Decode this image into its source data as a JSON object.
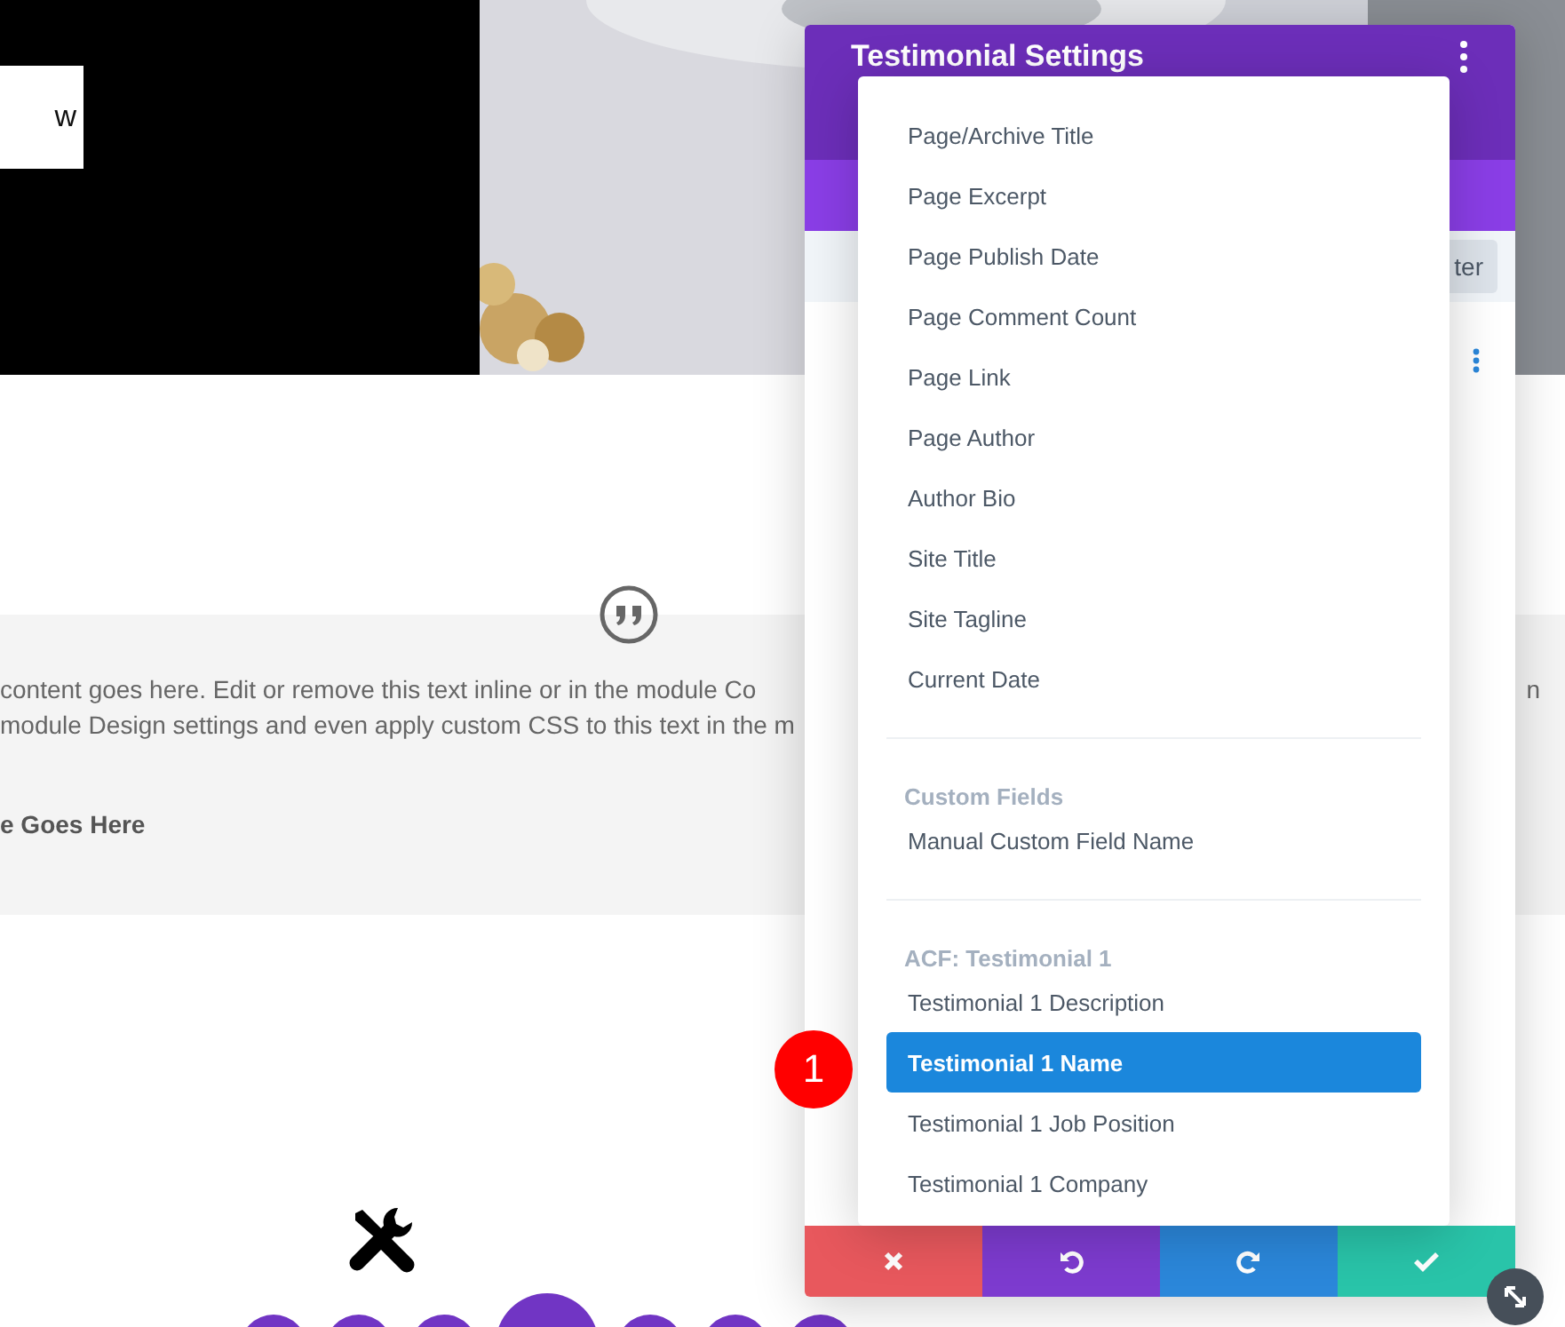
{
  "hero": {
    "button_text": "w"
  },
  "testimonial": {
    "body_lines": [
      "content goes here. Edit or remove this text inline or in the module Co",
      "module Design settings and even apply custom CSS to this text in the m"
    ],
    "right_fragment": "n",
    "author": "e Goes Here"
  },
  "settings_panel": {
    "title": "Testimonial Settings",
    "filter_label": "ter",
    "footer_buttons": [
      {
        "kind": "discard"
      },
      {
        "kind": "undo"
      },
      {
        "kind": "redo"
      },
      {
        "kind": "save"
      }
    ]
  },
  "dropdown": {
    "groups": [
      {
        "items": [
          {
            "label": "Page/Archive Title",
            "selected": false
          },
          {
            "label": "Page Excerpt",
            "selected": false
          },
          {
            "label": "Page Publish Date",
            "selected": false
          },
          {
            "label": "Page Comment Count",
            "selected": false
          },
          {
            "label": "Page Link",
            "selected": false
          },
          {
            "label": "Page Author",
            "selected": false
          },
          {
            "label": "Author Bio",
            "selected": false
          },
          {
            "label": "Site Title",
            "selected": false
          },
          {
            "label": "Site Tagline",
            "selected": false
          },
          {
            "label": "Current Date",
            "selected": false
          }
        ]
      },
      {
        "heading": "Custom Fields",
        "items": [
          {
            "label": "Manual Custom Field Name",
            "selected": false
          }
        ]
      },
      {
        "heading": "ACF: Testimonial 1",
        "items": [
          {
            "label": "Testimonial 1 Description",
            "selected": false
          },
          {
            "label": "Testimonial 1 Name",
            "selected": true
          },
          {
            "label": "Testimonial 1 Job Position",
            "selected": false
          },
          {
            "label": "Testimonial 1 Company",
            "selected": false
          }
        ]
      }
    ]
  },
  "callout": "1"
}
